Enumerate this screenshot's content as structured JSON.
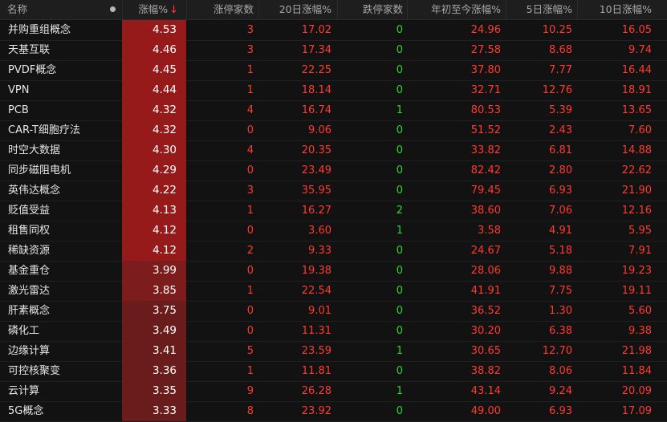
{
  "colors": {
    "background": "#121212",
    "header_background": "#1e1e1e",
    "up_red": "#ff3b30",
    "down_green": "#2bd82b",
    "heat_strong": "#971a1a",
    "heat_medium": "#7c1c1c",
    "heat_light": "#6a1c1c"
  },
  "header": {
    "name": "名称",
    "dot_icon": "dot-icon",
    "change_pct": "涨幅%",
    "sort_arrow": "↓",
    "limit_up_count": "涨停家数",
    "change_20d": "20日涨幅%",
    "limit_down_count": "跌停家数",
    "ytd_change": "年初至今涨幅%",
    "change_5d": "5日涨幅%",
    "change_10d": "10日涨幅%"
  },
  "rows": [
    {
      "name": "并购重组概念",
      "change_pct": "4.53",
      "limit_up_count": "3",
      "change_20d": "17.02",
      "limit_down_count": "0",
      "ytd_change": "24.96",
      "change_5d": "10.25",
      "change_10d": "16.05"
    },
    {
      "name": "天基互联",
      "change_pct": "4.46",
      "limit_up_count": "3",
      "change_20d": "17.34",
      "limit_down_count": "0",
      "ytd_change": "27.58",
      "change_5d": "8.68",
      "change_10d": "9.74"
    },
    {
      "name": "PVDF概念",
      "change_pct": "4.45",
      "limit_up_count": "1",
      "change_20d": "22.25",
      "limit_down_count": "0",
      "ytd_change": "37.80",
      "change_5d": "7.77",
      "change_10d": "16.44"
    },
    {
      "name": "VPN",
      "change_pct": "4.44",
      "limit_up_count": "1",
      "change_20d": "18.14",
      "limit_down_count": "0",
      "ytd_change": "32.71",
      "change_5d": "12.76",
      "change_10d": "18.91"
    },
    {
      "name": "PCB",
      "change_pct": "4.32",
      "limit_up_count": "4",
      "change_20d": "16.74",
      "limit_down_count": "1",
      "ytd_change": "80.53",
      "change_5d": "5.39",
      "change_10d": "13.65"
    },
    {
      "name": "CAR-T细胞疗法",
      "change_pct": "4.32",
      "limit_up_count": "0",
      "change_20d": "9.06",
      "limit_down_count": "0",
      "ytd_change": "51.52",
      "change_5d": "2.43",
      "change_10d": "7.60"
    },
    {
      "name": "时空大数据",
      "change_pct": "4.30",
      "limit_up_count": "4",
      "change_20d": "20.35",
      "limit_down_count": "0",
      "ytd_change": "33.82",
      "change_5d": "6.81",
      "change_10d": "14.88"
    },
    {
      "name": "同步磁阻电机",
      "change_pct": "4.29",
      "limit_up_count": "0",
      "change_20d": "23.49",
      "limit_down_count": "0",
      "ytd_change": "82.42",
      "change_5d": "2.80",
      "change_10d": "22.62"
    },
    {
      "name": "英伟达概念",
      "change_pct": "4.22",
      "limit_up_count": "3",
      "change_20d": "35.95",
      "limit_down_count": "0",
      "ytd_change": "79.45",
      "change_5d": "6.93",
      "change_10d": "21.90"
    },
    {
      "name": "贬值受益",
      "change_pct": "4.13",
      "limit_up_count": "1",
      "change_20d": "16.27",
      "limit_down_count": "2",
      "ytd_change": "38.60",
      "change_5d": "7.06",
      "change_10d": "12.16"
    },
    {
      "name": "租售同权",
      "change_pct": "4.12",
      "limit_up_count": "0",
      "change_20d": "3.60",
      "limit_down_count": "1",
      "ytd_change": "3.58",
      "change_5d": "4.91",
      "change_10d": "5.95"
    },
    {
      "name": "稀缺资源",
      "change_pct": "4.12",
      "limit_up_count": "2",
      "change_20d": "9.33",
      "limit_down_count": "0",
      "ytd_change": "24.67",
      "change_5d": "5.18",
      "change_10d": "7.91"
    },
    {
      "name": "基金重仓",
      "change_pct": "3.99",
      "limit_up_count": "0",
      "change_20d": "19.38",
      "limit_down_count": "0",
      "ytd_change": "28.06",
      "change_5d": "9.88",
      "change_10d": "19.23"
    },
    {
      "name": "激光雷达",
      "change_pct": "3.85",
      "limit_up_count": "1",
      "change_20d": "22.54",
      "limit_down_count": "0",
      "ytd_change": "41.91",
      "change_5d": "7.75",
      "change_10d": "19.11"
    },
    {
      "name": "肝素概念",
      "change_pct": "3.75",
      "limit_up_count": "0",
      "change_20d": "9.01",
      "limit_down_count": "0",
      "ytd_change": "36.52",
      "change_5d": "1.30",
      "change_10d": "5.60"
    },
    {
      "name": "磷化工",
      "change_pct": "3.49",
      "limit_up_count": "0",
      "change_20d": "11.31",
      "limit_down_count": "0",
      "ytd_change": "30.20",
      "change_5d": "6.38",
      "change_10d": "9.38"
    },
    {
      "name": "边缘计算",
      "change_pct": "3.41",
      "limit_up_count": "5",
      "change_20d": "23.59",
      "limit_down_count": "1",
      "ytd_change": "30.65",
      "change_5d": "12.70",
      "change_10d": "21.98"
    },
    {
      "name": "可控核聚变",
      "change_pct": "3.36",
      "limit_up_count": "1",
      "change_20d": "11.81",
      "limit_down_count": "0",
      "ytd_change": "38.82",
      "change_5d": "8.06",
      "change_10d": "11.84"
    },
    {
      "name": "云计算",
      "change_pct": "3.35",
      "limit_up_count": "9",
      "change_20d": "26.28",
      "limit_down_count": "1",
      "ytd_change": "43.14",
      "change_5d": "9.24",
      "change_10d": "20.09"
    },
    {
      "name": "5G概念",
      "change_pct": "3.33",
      "limit_up_count": "8",
      "change_20d": "23.92",
      "limit_down_count": "0",
      "ytd_change": "49.00",
      "change_5d": "6.93",
      "change_10d": "17.09"
    }
  ]
}
